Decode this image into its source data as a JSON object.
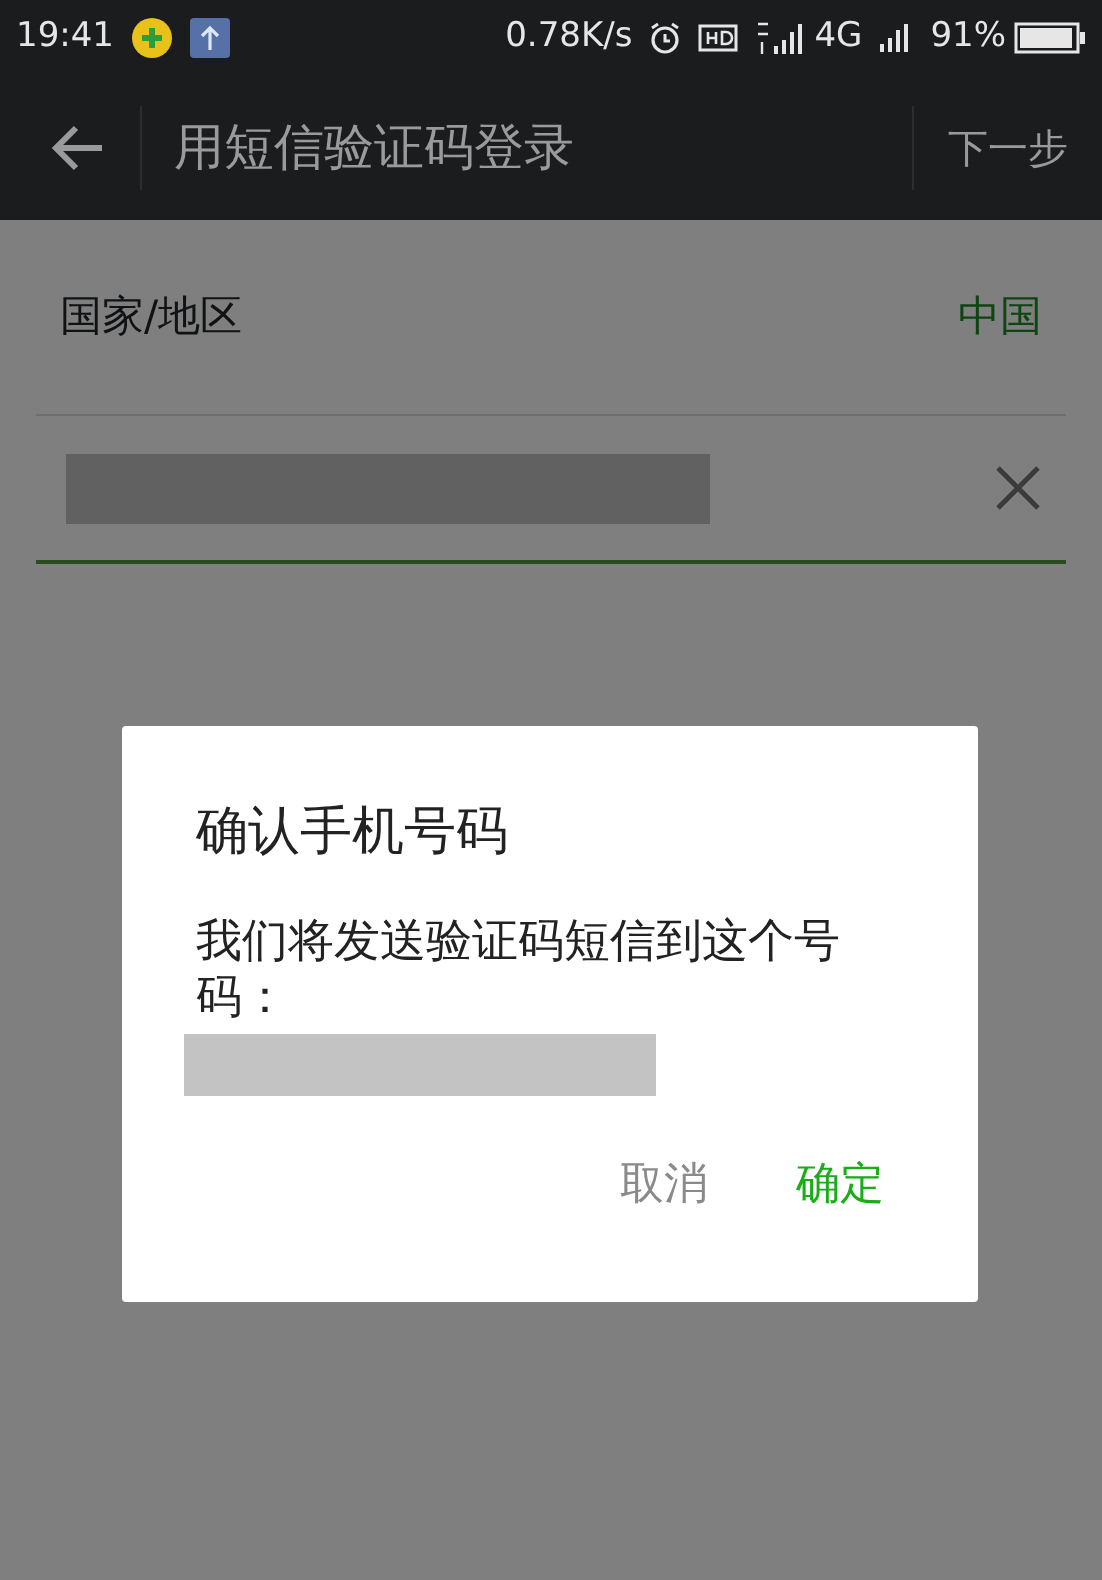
{
  "status_bar": {
    "time": "19:41",
    "network_speed": "0.78K/s",
    "network_type": "4G",
    "battery": "91%"
  },
  "toolbar": {
    "title": "用短信验证码登录",
    "action": "下一步"
  },
  "form": {
    "country_label": "国家/地区",
    "country_value": "中国"
  },
  "dialog": {
    "title": "确认手机号码",
    "message": "我们将发送验证码短信到这个号码：",
    "buttons": [
      {
        "label": "取消",
        "kind": "cancel"
      },
      {
        "label": "确定",
        "kind": "confirm"
      }
    ]
  }
}
